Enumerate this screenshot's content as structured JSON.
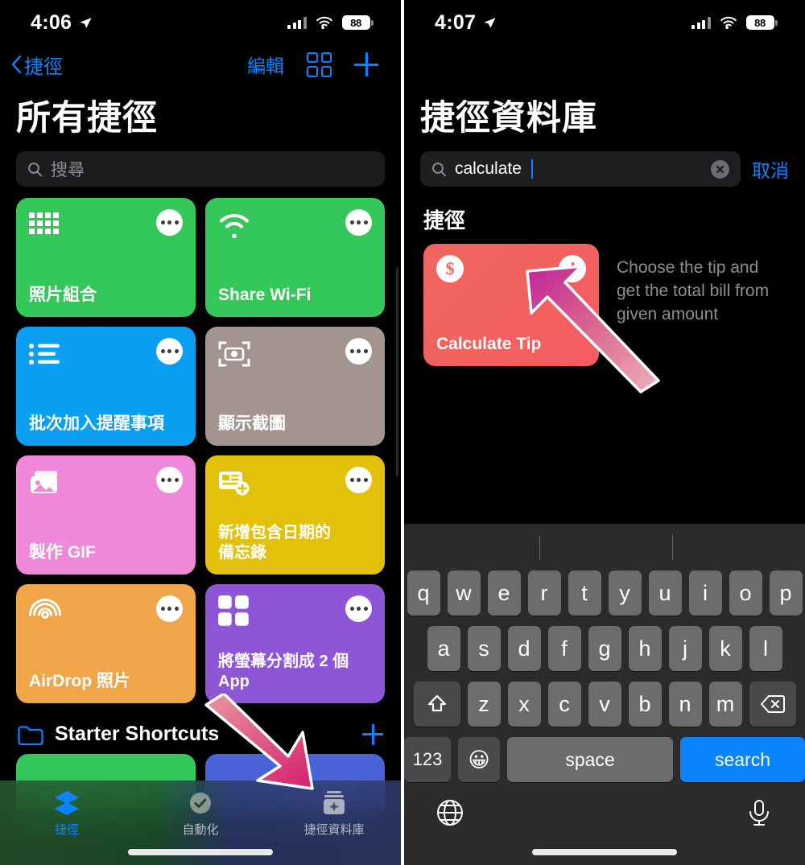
{
  "left": {
    "status": {
      "time": "4:06",
      "battery": "88",
      "location_icon": "location-arrow-icon",
      "signal_icon": "cellular-bars-icon",
      "wifi_icon": "wifi-icon"
    },
    "nav": {
      "back_label": "捷徑",
      "edit_label": "編輯",
      "grid_icon": "grid-view-icon",
      "add_icon": "plus-icon"
    },
    "title": "所有捷徑",
    "search": {
      "placeholder": "搜尋",
      "icon": "search-icon"
    },
    "cards": [
      {
        "label": "照片組合",
        "color": "#34c759",
        "icon": "photo-grid-icon"
      },
      {
        "label": "Share Wi-Fi",
        "color": "#34c759",
        "icon": "wifi-icon"
      },
      {
        "label": "批次加入提醒事項",
        "color": "#0a9ff0",
        "icon": "bullet-list-icon"
      },
      {
        "label": "顯示截圖",
        "color": "#a39490",
        "icon": "screenshot-camera-icon"
      },
      {
        "label": "製作 GIF",
        "color": "#ef88d8",
        "icon": "photo-stack-icon"
      },
      {
        "label": "新增包含日期的\n備忘錄",
        "color": "#e3c10a",
        "icon": "note-add-icon"
      },
      {
        "label": "AirDrop 照片",
        "color": "#f0a martinez",
        "icon": "airdrop-icon"
      },
      {
        "label": "將螢幕分割成 2 個\nApp",
        "color": "#8e55d6",
        "icon": "split-view-icon"
      }
    ],
    "card_colors": [
      "#34c759",
      "#34c759",
      "#0a9ff0",
      "#a39490",
      "#ef88d8",
      "#e3c10a",
      "#f0a548",
      "#8e55d6"
    ],
    "folder": {
      "name": "Starter Shortcuts",
      "icon": "folder-icon",
      "add_icon": "plus-icon"
    },
    "tabs": [
      {
        "label": "捷徑",
        "icon": "shortcuts-layers-icon",
        "active": true
      },
      {
        "label": "自動化",
        "icon": "automation-clock-icon",
        "active": false
      },
      {
        "label": "捷徑資料庫",
        "icon": "gallery-sparkle-icon",
        "active": false
      }
    ]
  },
  "right": {
    "status": {
      "time": "4:07",
      "battery": "88"
    },
    "title": "捷徑資料庫",
    "search": {
      "value": "calculate",
      "icon": "search-icon",
      "clear_icon": "clear-circle-icon",
      "cancel_label": "取消"
    },
    "section_title": "捷徑",
    "result": {
      "card_label": "Calculate Tip",
      "dollar_badge": "$",
      "description": "Choose the tip and get the total bill from given amount"
    },
    "keyboard": {
      "row1": [
        "q",
        "w",
        "e",
        "r",
        "t",
        "y",
        "u",
        "i",
        "o",
        "p"
      ],
      "row2": [
        "a",
        "s",
        "d",
        "f",
        "g",
        "h",
        "j",
        "k",
        "l"
      ],
      "row3": [
        "z",
        "x",
        "c",
        "v",
        "b",
        "n",
        "m"
      ],
      "shift_icon": "shift-arrow-icon",
      "backspace_icon": "backspace-icon",
      "numbers_label": "123",
      "emoji_icon": "emoji-smiley-icon",
      "space_label": "space",
      "search_label": "search",
      "globe_icon": "globe-icon",
      "mic_icon": "microphone-icon"
    }
  },
  "overlays": {
    "arrow_left": "pink-gradient-arrow-down-right",
    "arrow_right": "pink-gradient-arrow-up-left"
  }
}
